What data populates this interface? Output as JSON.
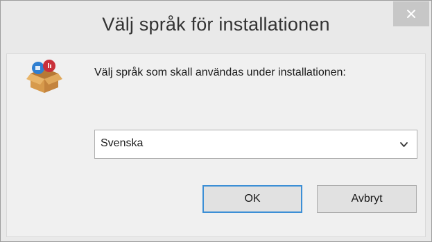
{
  "window": {
    "title": "Välj språk för installationen",
    "close_icon": "close-icon"
  },
  "dialog": {
    "icon": "installer-box-icon",
    "prompt": "Välj språk som skall användas under installationen:",
    "language_select": {
      "selected": "Svenska"
    },
    "buttons": {
      "ok": "OK",
      "cancel": "Avbryt"
    }
  },
  "colors": {
    "title_bar": "#e9e9e9",
    "content": "#f0f0f0",
    "close_button": "#c7c7c7",
    "focus_border": "#3c8fd6"
  }
}
